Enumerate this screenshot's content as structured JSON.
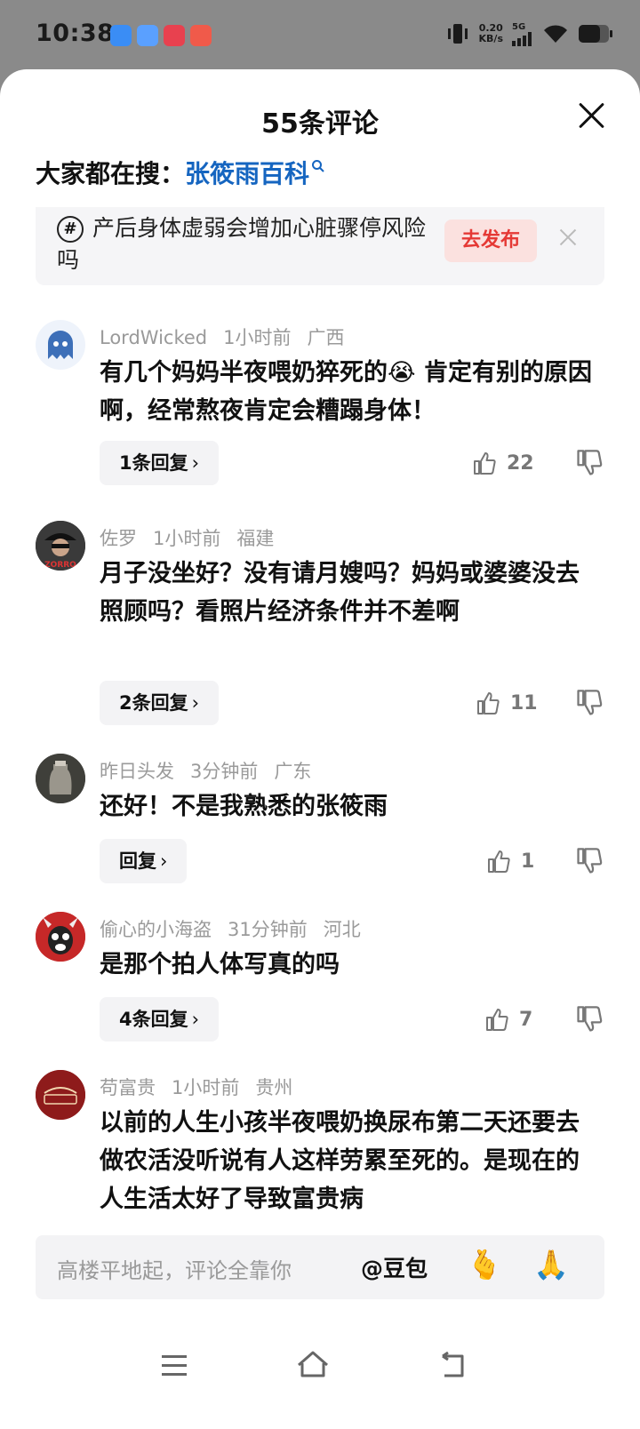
{
  "status_bar": {
    "time": "10:38",
    "net_speed_value": "0.20",
    "net_speed_unit": "KB/s",
    "network": "5G"
  },
  "header": {
    "title": "55条评论",
    "search_prefix": "大家都在搜：",
    "search_link": "张筱雨百科"
  },
  "topic": {
    "text": "产后身体虚弱会增加心脏骤停风险吗",
    "publish_label": "去发布"
  },
  "comments": [
    {
      "user": "LordWicked",
      "time": "1小时前",
      "region": "广西",
      "text": "有几个妈妈半夜喂奶猝死的😭 肯定有别的原因啊，经常熬夜肯定会糟蹋身体！",
      "reply_label": "1条回复",
      "likes": "22"
    },
    {
      "user": "佐罗",
      "time": "1小时前",
      "region": "福建",
      "text": "月子没坐好？没有请月嫂吗？妈妈或婆婆没去照顾吗？看照片经济条件并不差啊",
      "reply_label": "2条回复",
      "likes": "11"
    },
    {
      "user": "昨日头发",
      "time": "3分钟前",
      "region": "广东",
      "text": "还好！不是我熟悉的张筱雨",
      "reply_label": "回复",
      "likes": "1"
    },
    {
      "user": "偷心的小海盗",
      "time": "31分钟前",
      "region": "河北",
      "text": "是那个拍人体写真的吗",
      "reply_label": "4条回复",
      "likes": "7"
    },
    {
      "user": "苟富贵",
      "time": "1小时前",
      "region": "贵州",
      "text": "以前的人生小孩半夜喂奶换尿布第二天还要去做农活没听说有人这样劳累至死的。是现在的人生活太好了导致富贵病",
      "reply_label": "",
      "likes": ""
    }
  ],
  "input": {
    "placeholder": "高楼平地起，评论全靠你",
    "mention": "@豆包"
  },
  "icons": [
    "close-icon",
    "search-icon",
    "hashtag-icon",
    "thumbs-up-icon",
    "thumbs-down-icon",
    "menu-icon",
    "home-icon",
    "back-icon"
  ],
  "colors": {
    "link": "#1565c0",
    "publish": "#e53935"
  }
}
